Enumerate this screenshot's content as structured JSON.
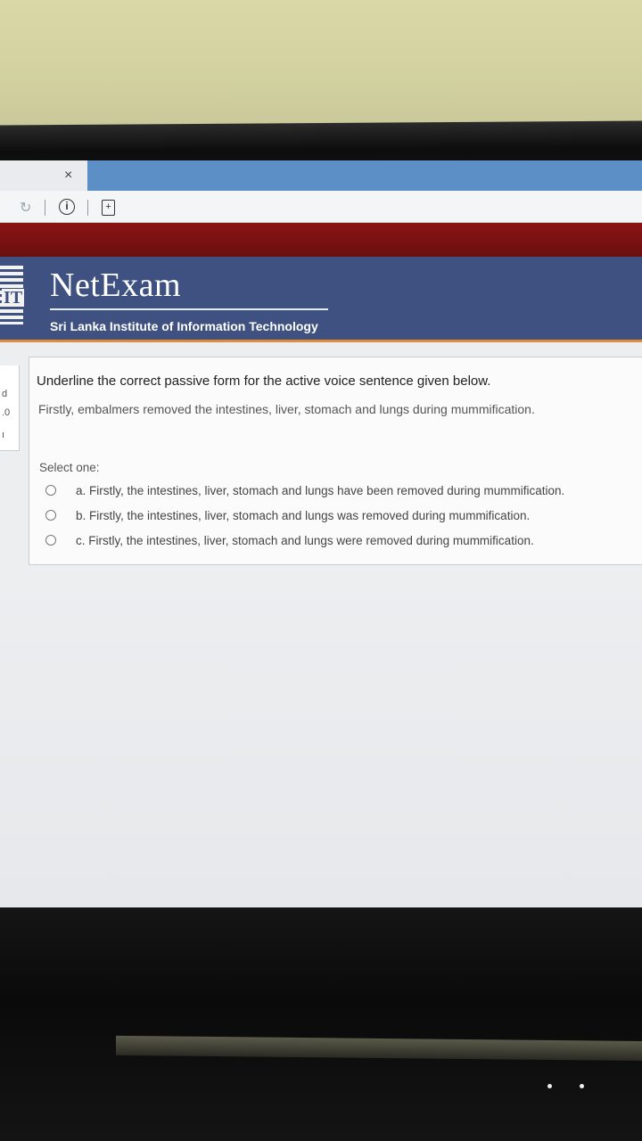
{
  "browser": {
    "tab_close_glyph": "×",
    "reload_glyph": "↻",
    "info_glyph": "i",
    "page_glyph": "+",
    "accent_tab": "#5b8fc6"
  },
  "header": {
    "logo_text": "IT",
    "brand": "NetExam",
    "institution": "Sri Lanka Institute of Information Technology",
    "band_color": "#3e5180",
    "top_bar_color": "#7a1212",
    "underline_color": "#e08a3c"
  },
  "sidebar_fragment": {
    "lines": [
      "d",
      ".0",
      "ı"
    ]
  },
  "question": {
    "instruction": "Underline the correct passive form for the active voice sentence given below.",
    "sentence": "Firstly, embalmers removed the intestines, liver, stomach and lungs during mummification.",
    "select_label": "Select one:",
    "options": [
      {
        "label": "a. Firstly, the intestines, liver, stomach and lungs have been removed during mummification.",
        "selected": false
      },
      {
        "label": "b. Firstly, the intestines, liver, stomach and lungs was removed during mummification.",
        "selected": false
      },
      {
        "label": "c. Firstly, the intestines, liver, stomach and lungs were removed during mummification.",
        "selected": false
      }
    ]
  }
}
